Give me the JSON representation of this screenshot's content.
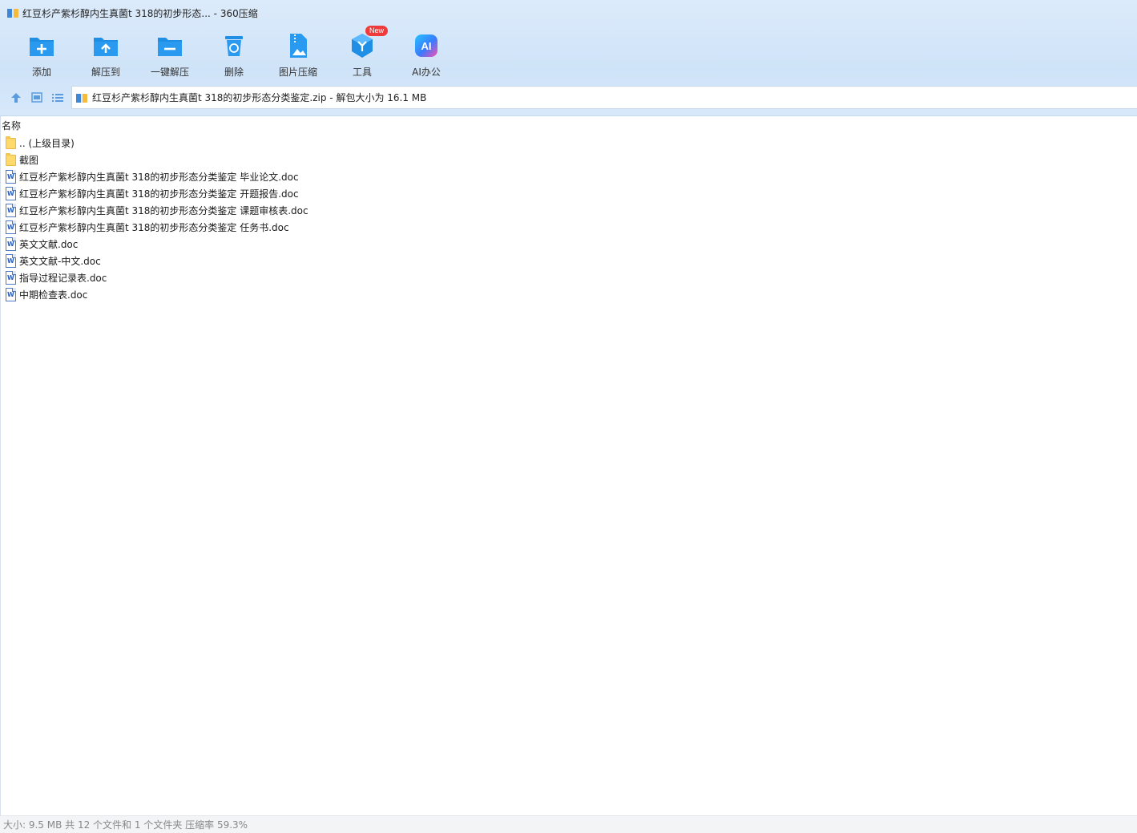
{
  "window": {
    "title": "红豆杉产紫杉醇内生真菌t 318的初步形态... - 360压缩"
  },
  "toolbar": {
    "items": [
      {
        "label": "添加",
        "icon": "add-folder-icon"
      },
      {
        "label": "解压到",
        "icon": "extract-to-icon"
      },
      {
        "label": "一键解压",
        "icon": "one-click-extract-icon"
      },
      {
        "label": "删除",
        "icon": "recycle-bin-icon"
      },
      {
        "label": "图片压缩",
        "icon": "image-compress-icon"
      },
      {
        "label": "工具",
        "icon": "tools-icon",
        "badge": "New"
      },
      {
        "label": "AI办公",
        "icon": "ai-office-icon"
      }
    ]
  },
  "nav": {
    "path_text": "红豆杉产紫杉醇内生真菌t 318的初步形态分类鉴定.zip - 解包大小为 16.1 MB"
  },
  "list": {
    "column_name": "名称",
    "rows": [
      {
        "name": ".. (上级目录)",
        "type": "folder"
      },
      {
        "name": "截图",
        "type": "folder"
      },
      {
        "name": "红豆杉产紫杉醇内生真菌t 318的初步形态分类鉴定 毕业论文.doc",
        "type": "doc"
      },
      {
        "name": "红豆杉产紫杉醇内生真菌t 318的初步形态分类鉴定 开题报告.doc",
        "type": "doc"
      },
      {
        "name": "红豆杉产紫杉醇内生真菌t 318的初步形态分类鉴定 课题审核表.doc",
        "type": "doc"
      },
      {
        "name": "红豆杉产紫杉醇内生真菌t 318的初步形态分类鉴定 任务书.doc",
        "type": "doc"
      },
      {
        "name": "英文文献.doc",
        "type": "doc"
      },
      {
        "name": "英文文献-中文.doc",
        "type": "doc"
      },
      {
        "name": "指导过程记录表.doc",
        "type": "doc"
      },
      {
        "name": "中期检查表.doc",
        "type": "doc"
      }
    ]
  },
  "status": {
    "text": "大小: 9.5 MB 共 12 个文件和 1 个文件夹 压缩率 59.3%"
  },
  "colors": {
    "accent": "#1f8fe6",
    "topbar": "#d7e8fa",
    "badge": "#ef3b3b"
  }
}
